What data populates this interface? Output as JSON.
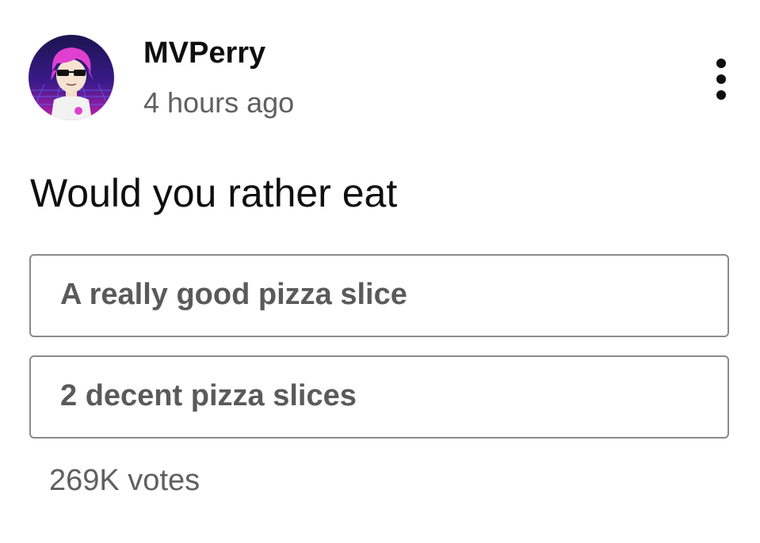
{
  "post": {
    "author": "MVPerry",
    "timestamp": "4 hours ago",
    "avatar_icon": "anime-character-avatar",
    "menu_icon": "more-vertical-icon",
    "question": "Would you rather eat",
    "options": [
      {
        "label": "A really good pizza slice"
      },
      {
        "label": "2 decent pizza slices"
      }
    ],
    "votes": "269K votes"
  },
  "colors": {
    "text_primary": "#0f0f0f",
    "text_secondary": "#606060",
    "option_text": "#5a5a5a",
    "option_border": "#8a8a8a",
    "avatar_accent": "#e040d0"
  }
}
